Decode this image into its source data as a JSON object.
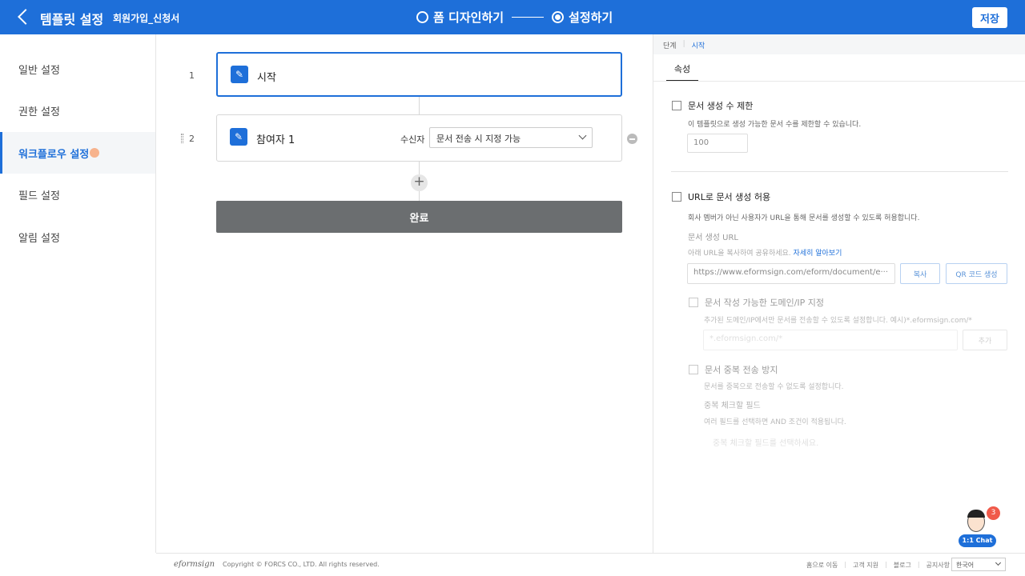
{
  "header": {
    "title": "템플릿 설정",
    "subtitle": "회원가입_신청서",
    "steps": [
      {
        "label": "폼 디자인하기",
        "active": false
      },
      {
        "label": "설정하기",
        "active": true
      }
    ],
    "save_label": "저장"
  },
  "sidebar": {
    "items": [
      {
        "label": "일반 설정",
        "active": false
      },
      {
        "label": "권한 설정",
        "active": false
      },
      {
        "label": "워크플로우 설정",
        "active": true
      },
      {
        "label": "필드 설정",
        "active": false
      },
      {
        "label": "알림 설정",
        "active": false
      }
    ]
  },
  "workflow": {
    "nodes": [
      {
        "number": "1",
        "label": "시작",
        "icon": "user-edit-icon"
      },
      {
        "number": "2",
        "label": "참여자 1",
        "icon": "user-edit-icon",
        "recipient_label": "수신자",
        "recipient_value": "문서 전송 시 지정 가능"
      }
    ],
    "add_symbol": "+",
    "done_label": "완료"
  },
  "panel": {
    "breadcrumb": [
      "단계",
      "시작"
    ],
    "tab": "속성",
    "limit": {
      "label": "문서 생성 수 제한",
      "desc": "이 템플릿으로 생성 가능한 문서 수를 제한할 수 있습니다.",
      "value": "100"
    },
    "url": {
      "label": "URL로 문서 생성 허용",
      "desc": "회사 멤버가 아닌 사용자가 URL을 통해 문서를 생성할 수 있도록 허용합니다.",
      "field_label": "문서 생성 URL",
      "hint": "아래 URL을 복사하여 공유하세요.",
      "hint_link": "자세히 알아보기",
      "url_value": "https://www.eformsign.com/eform/document/e···",
      "copy_label": "복사",
      "qr_label": "QR 코드 생성"
    },
    "domain": {
      "label": "문서 작성 가능한 도메인/IP 지정",
      "desc": "추가된 도메인/IP에서만 문서를 전송할 수 있도록 설정합니다. 예시)*.eformsign.com/*",
      "placeholder": "*.eformsign.com/*",
      "add_label": "추가"
    },
    "dup": {
      "label": "문서 중복 전송 방지",
      "desc": "문서를 중복으로 전송할 수 없도록 설정합니다.",
      "field_label": "중복 체크할 필드",
      "field_desc": "여러 필드를 선택하면 AND 조건이 적용됩니다.",
      "placeholder": "중복 체크할 필드를 선택하세요."
    }
  },
  "footer": {
    "logo": "eformsign",
    "copyright": "Copyright © FORCS CO., LTD. All rights reserved.",
    "links": [
      "홈으로 이동",
      "고객 지원",
      "블로그",
      "공지사항"
    ],
    "language": "한국어"
  },
  "chat": {
    "label": "1:1 Chat",
    "badge": "3"
  },
  "colors": {
    "primary": "#1e6fd9",
    "done_button": "#6b6e70",
    "badge": "#f05a4a"
  }
}
